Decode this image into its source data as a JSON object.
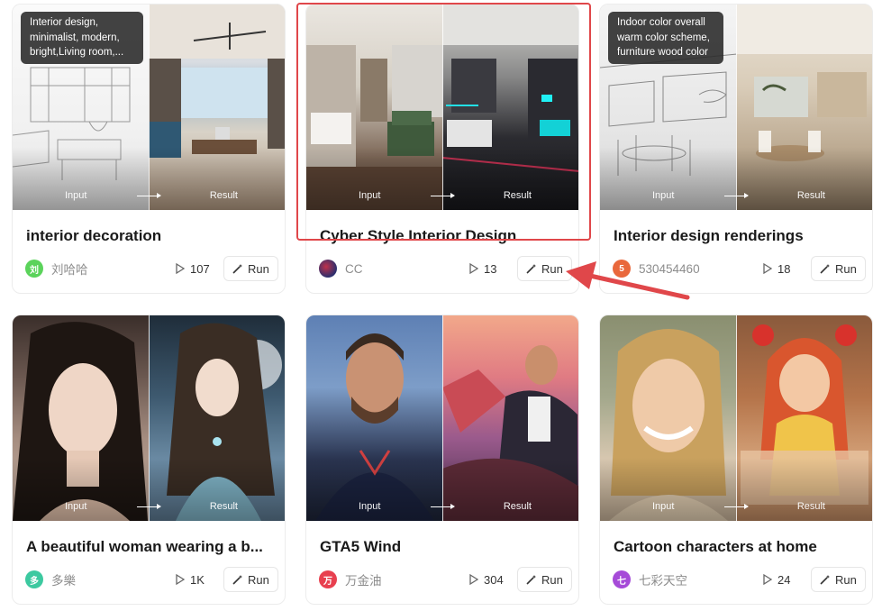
{
  "labels": {
    "input": "Input",
    "result": "Result",
    "run": "Run"
  },
  "colors": {
    "highlight": "#e0474a",
    "arrow": "#e0474a"
  },
  "cards": [
    {
      "title": "interior decoration",
      "author": "刘哈哈",
      "avatar_text": "刘",
      "avatar_color": "#5bd35b",
      "plays": "107",
      "tooltip": "Interior design, minimalist, modern, bright,Living room,..."
    },
    {
      "title": "Cyber Style Interior Design",
      "author": "CC",
      "avatar_text": "",
      "avatar_color": "#2b2f6e",
      "plays": "13"
    },
    {
      "title": "Interior design renderings",
      "author": "530454460",
      "avatar_text": "5",
      "avatar_color": "#e9683c",
      "plays": "18",
      "tooltip": "Indoor color overall warm color scheme, furniture wood color"
    },
    {
      "title": "A beautiful woman wearing a b...",
      "author": "多樂",
      "avatar_text": "多",
      "avatar_color": "#3cc9a0",
      "plays": "1K"
    },
    {
      "title": "GTA5 Wind",
      "author": "万金油",
      "avatar_text": "万",
      "avatar_color": "#e8404f",
      "plays": "304"
    },
    {
      "title": "Cartoon characters at home",
      "author": "七彩天空",
      "avatar_text": "七",
      "avatar_color": "#a64bd8",
      "plays": "24"
    }
  ]
}
